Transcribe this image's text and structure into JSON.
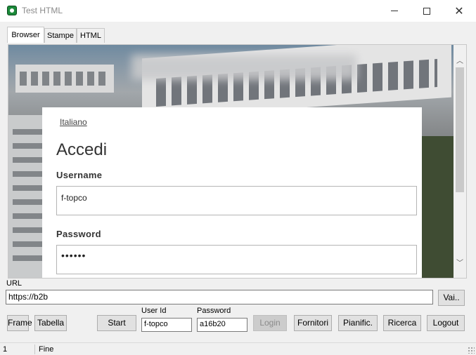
{
  "window": {
    "title": "Test HTML",
    "icons": [
      "app-icon",
      "minimize-icon",
      "maximize-icon",
      "close-icon"
    ]
  },
  "tabs": [
    {
      "label": "Browser",
      "active": true
    },
    {
      "label": "Stampe",
      "active": false
    },
    {
      "label": "HTML",
      "active": false
    }
  ],
  "webpage": {
    "language_link": "Italiano",
    "heading": "Accedi",
    "username_label": "Username",
    "username_value": "f-topco",
    "password_label": "Password",
    "password_value": "••••••"
  },
  "url": {
    "label": "URL",
    "value": "https://b2b",
    "go_button": "Vai.."
  },
  "toolbar": {
    "frame_button": "Frame",
    "tabella_button": "Tabella",
    "start_button": "Start",
    "userid_label": "User Id",
    "userid_value": "f-topco",
    "password_label": "Password",
    "password_value": "a16b20",
    "login_button": "Login",
    "fornitori_button": "Fornitori",
    "pianific_button": "Pianific.",
    "ricerca_button": "Ricerca",
    "logout_button": "Logout"
  },
  "status": {
    "cell1": "1",
    "cell2": "Fine"
  }
}
